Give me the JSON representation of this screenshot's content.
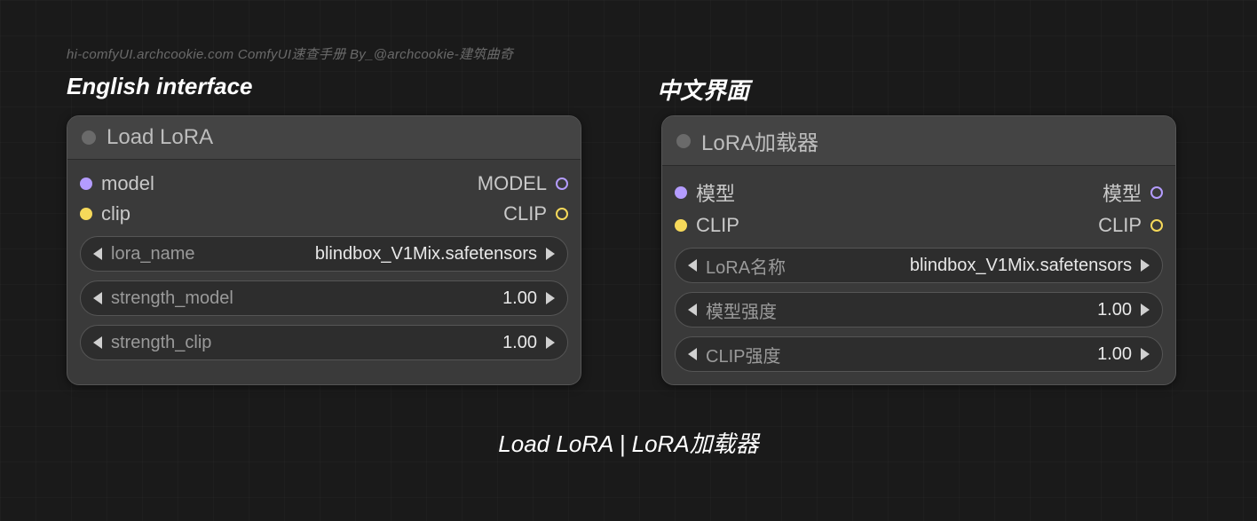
{
  "watermark": "hi-comfyUI.archcookie.com ComfyUI速查手册 By_@archcookie-建筑曲奇",
  "sections": {
    "en_title": "English interface",
    "zh_title": "中文界面"
  },
  "caption": "Load LoRA | LoRA加载器",
  "colors": {
    "purple": "#b49cff",
    "yellow": "#f6d95a"
  },
  "panels": {
    "en": {
      "title": "Load LoRA",
      "inputs": [
        {
          "label": "model",
          "color": "purple"
        },
        {
          "label": "clip",
          "color": "yellow"
        }
      ],
      "outputs": [
        {
          "label": "MODEL",
          "color": "purple"
        },
        {
          "label": "CLIP",
          "color": "yellow"
        }
      ],
      "widgets": [
        {
          "label": "lora_name",
          "value": "blindbox_V1Mix.safetensors"
        },
        {
          "label": "strength_model",
          "value": "1.00"
        },
        {
          "label": "strength_clip",
          "value": "1.00"
        }
      ]
    },
    "zh": {
      "title": "LoRA加载器",
      "inputs": [
        {
          "label": "模型",
          "color": "purple"
        },
        {
          "label": "CLIP",
          "color": "yellow"
        }
      ],
      "outputs": [
        {
          "label": "模型",
          "color": "purple"
        },
        {
          "label": "CLIP",
          "color": "yellow"
        }
      ],
      "widgets": [
        {
          "label": "LoRA名称",
          "value": "blindbox_V1Mix.safetensors"
        },
        {
          "label": "模型强度",
          "value": "1.00"
        },
        {
          "label": "CLIP强度",
          "value": "1.00"
        }
      ]
    }
  }
}
